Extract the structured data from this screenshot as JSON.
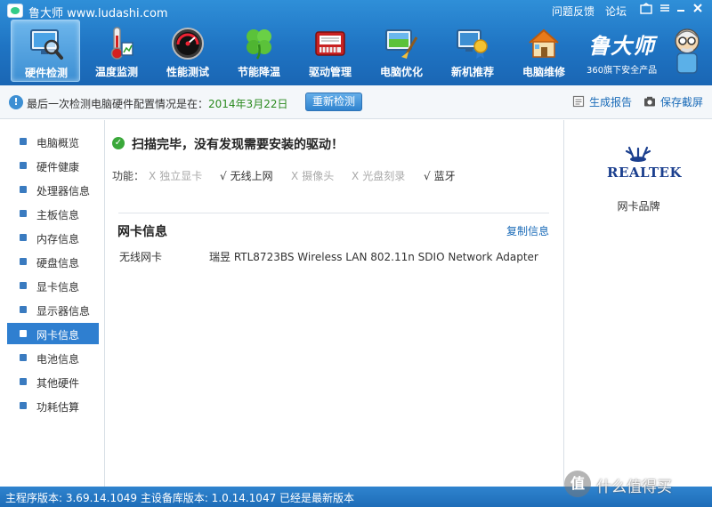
{
  "app": {
    "title": "鲁大师 www.ludashi.com"
  },
  "top_links": {
    "feedback": "问题反馈",
    "forum": "论坛"
  },
  "nav": [
    {
      "label": "硬件检测",
      "icon": "monitor-magnifier-icon",
      "active": true
    },
    {
      "label": "温度监测",
      "icon": "thermometer-icon"
    },
    {
      "label": "性能测试",
      "icon": "speedometer-icon"
    },
    {
      "label": "节能降温",
      "icon": "clover-icon"
    },
    {
      "label": "驱动管理",
      "icon": "driver-chip-icon"
    },
    {
      "label": "电脑优化",
      "icon": "screen-broom-icon"
    },
    {
      "label": "新机推荐",
      "icon": "medal-screen-icon"
    },
    {
      "label": "电脑维修",
      "icon": "house-wrench-icon"
    }
  ],
  "brand": {
    "title": "鲁大师",
    "subtitle": "360旗下安全产品"
  },
  "infobar": {
    "text": "最后一次检测电脑硬件配置情况是在：",
    "date": "2014年3月22日",
    "rescan": "重新检测",
    "report": "生成报告",
    "screenshot": "保存截屏"
  },
  "sidebar": [
    {
      "label": "电脑概览"
    },
    {
      "label": "硬件健康"
    },
    {
      "label": "处理器信息"
    },
    {
      "label": "主板信息"
    },
    {
      "label": "内存信息"
    },
    {
      "label": "硬盘信息"
    },
    {
      "label": "显卡信息"
    },
    {
      "label": "显示器信息"
    },
    {
      "label": "网卡信息",
      "active": true
    },
    {
      "label": "电池信息"
    },
    {
      "label": "其他硬件"
    },
    {
      "label": "功耗估算"
    }
  ],
  "main": {
    "scan_message": "扫描完毕，没有发现需要安装的驱动！",
    "features_label": "功能：",
    "features": [
      {
        "mark": "X",
        "label": "独立显卡",
        "supported": false
      },
      {
        "mark": "√",
        "label": "无线上网",
        "supported": true
      },
      {
        "mark": "X",
        "label": "摄像头",
        "supported": false
      },
      {
        "mark": "X",
        "label": "光盘刻录",
        "supported": false
      },
      {
        "mark": "√",
        "label": "蓝牙",
        "supported": true
      }
    ],
    "section_title": "网卡信息",
    "copy_info": "复制信息",
    "row": {
      "key": "无线网卡",
      "value": "瑞昱 RTL8723BS Wireless LAN 802.11n SDIO Network Adapter"
    }
  },
  "right_panel": {
    "logo_text": "REALTEK",
    "caption": "网卡品牌"
  },
  "statusbar": {
    "text": "主程序版本: 3.69.14.1049   主设备库版本: 1.0.14.1047   已经是最新版本"
  },
  "watermark": {
    "badge": "值",
    "text": "什么值得买"
  },
  "colors": {
    "header_blue": "#1f74c3",
    "accent_green": "#2a8a1e",
    "link_blue": "#1a6bb8"
  }
}
